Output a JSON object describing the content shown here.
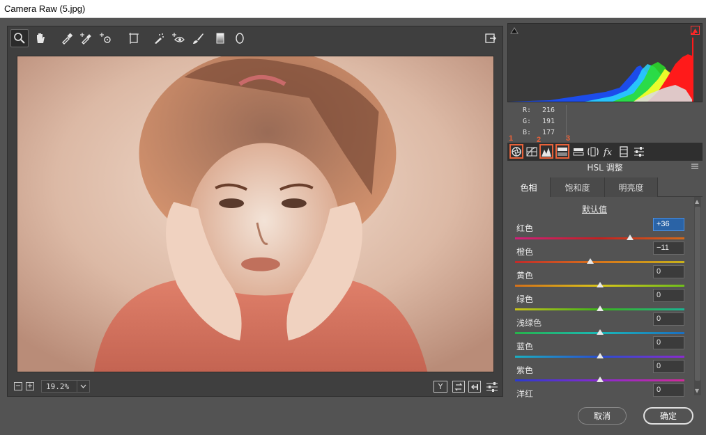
{
  "window": {
    "title": "Camera Raw (5.jpg)"
  },
  "toolbar": {
    "tools": [
      {
        "name": "zoom-tool",
        "icon": "magnifier-icon",
        "active": true
      },
      {
        "name": "hand-tool",
        "icon": "hand-icon"
      },
      {
        "name": "white-balance-tool",
        "icon": "eyedropper-icon"
      },
      {
        "name": "color-sampler-tool",
        "icon": "color-sampler-icon"
      },
      {
        "name": "targeted-adjustment-tool",
        "icon": "target-adjust-icon"
      },
      {
        "name": "transform-tool",
        "icon": "transform-icon"
      },
      {
        "name": "spot-removal-tool",
        "icon": "spot-removal-icon"
      },
      {
        "name": "red-eye-tool",
        "icon": "red-eye-icon"
      },
      {
        "name": "adjustment-brush-tool",
        "icon": "brush-icon"
      },
      {
        "name": "graduated-filter-tool",
        "icon": "gradient-icon"
      },
      {
        "name": "radial-filter-tool",
        "icon": "ellipse-icon"
      }
    ],
    "right_icon": "open-preferences-icon"
  },
  "bottom": {
    "zoom_value": "19.2%",
    "minus": "−",
    "plus": "+",
    "view_icons": [
      "y-view-icon",
      "cycle-view-icon",
      "swap-icon",
      "settings-sliders-icon"
    ],
    "y_label": "Y"
  },
  "readout": {
    "r_label": "R:",
    "r_value": "216",
    "g_label": "G:",
    "g_value": "191",
    "b_label": "B:",
    "b_value": "177"
  },
  "panel_tabs": {
    "icons": [
      "basic-icon",
      "tone-curve-icon",
      "detail-icon",
      "hsl-icon",
      "split-toning-icon",
      "lens-icon",
      "fx-icon",
      "camera-calibration-icon",
      "presets-icon"
    ],
    "markers": [
      "1",
      "2",
      "3"
    ]
  },
  "panel": {
    "title": "HSL 调整"
  },
  "hsl_tabs": [
    {
      "label": "色相",
      "active": true
    },
    {
      "label": "饱和度",
      "active": false
    },
    {
      "label": "明亮度",
      "active": false
    }
  ],
  "default_link": "默认值",
  "sliders": [
    {
      "label": "红色",
      "value": "+36",
      "level": 0.68,
      "focused": true,
      "track": "linear-gradient(to right,#d0207a,#c42020,#d46a1a)"
    },
    {
      "label": "橙色",
      "value": "−11",
      "level": 0.445,
      "track": "linear-gradient(to right,#c22a2a,#d9761a,#c8b21a)"
    },
    {
      "label": "黄色",
      "value": "0",
      "level": 0.5,
      "track": "linear-gradient(to right,#d4701a,#d9c51a,#6fbf1a)"
    },
    {
      "label": "绿色",
      "value": "0",
      "level": 0.5,
      "track": "linear-gradient(to right,#c9c21a,#3cb41a,#1ab493)"
    },
    {
      "label": "浅绿色",
      "value": "0",
      "level": 0.5,
      "track": "linear-gradient(to right,#27b44a,#1ab8b8,#1a6ec2)"
    },
    {
      "label": "蓝色",
      "value": "0",
      "level": 0.5,
      "track": "linear-gradient(to right,#1ab0c2,#2a4ed0,#8a2ad0)"
    },
    {
      "label": "紫色",
      "value": "0",
      "level": 0.5,
      "track": "linear-gradient(to right,#2a3ad0,#8a2ad0,#d02a9a)"
    },
    {
      "label": "洋红",
      "value": "0",
      "level": 0.5,
      "track": "linear-gradient(to right,#8a2ad0,#d02a8a,#d02a3a)"
    }
  ],
  "buttons": {
    "cancel": "取消",
    "ok": "确定"
  },
  "colors": {
    "accent_marker": "#e8623a",
    "panel_bg": "#535353",
    "dark_bg": "#3f3f3f"
  }
}
